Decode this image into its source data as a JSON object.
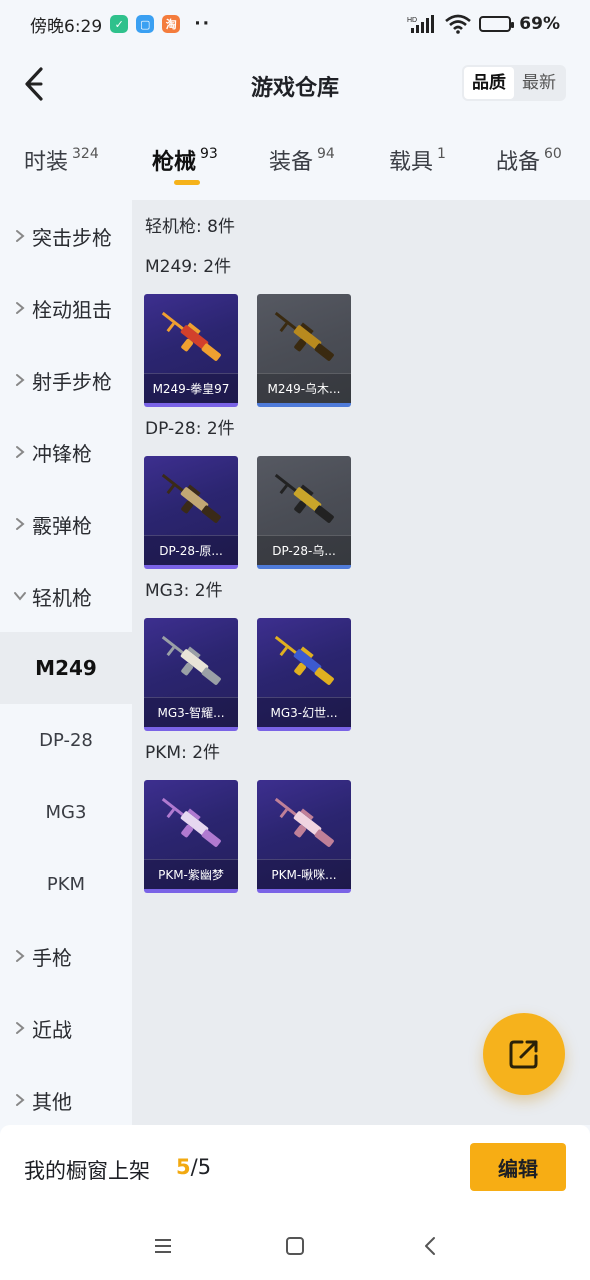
{
  "status_bar": {
    "time": "傍晚6:29",
    "app_icons": [
      {
        "icon": "shield-app-icon",
        "color": "#2fc18c",
        "glyph": "✓"
      },
      {
        "icon": "chat-app-icon",
        "color": "#3aa0f2",
        "glyph": "▢"
      },
      {
        "icon": "taobao-app-icon",
        "color": "#f47c3c",
        "glyph": "淘"
      }
    ],
    "more": "··",
    "network": "HD",
    "battery_percent": 69,
    "battery_text": "69%"
  },
  "header": {
    "title": "游戏仓库",
    "sort_options": [
      "品质",
      "最新"
    ],
    "sort_active": 0
  },
  "tabs": [
    {
      "label": "时装",
      "count": "324"
    },
    {
      "label": "枪械",
      "count": "93",
      "active": true
    },
    {
      "label": "装备",
      "count": "94"
    },
    {
      "label": "载具",
      "count": "1"
    },
    {
      "label": "战备",
      "count": "60"
    }
  ],
  "sidebar": {
    "categories": [
      "突击步枪",
      "栓动狙击",
      "射手步枪",
      "冲锋枪",
      "霰弹枪",
      "轻机枪",
      "手枪",
      "近战",
      "其他"
    ],
    "expanded": "轻机枪",
    "subitems": [
      "M249",
      "DP-28",
      "MG3",
      "PKM"
    ],
    "active_sub": "M249"
  },
  "content": {
    "total": "轻机枪: 8件",
    "groups": [
      {
        "title": "M249: 2件",
        "items": [
          {
            "name": "M249-拳皇97",
            "rarity": "purple",
            "weapon_color": "#d2402c",
            "accent": "#f0a030"
          },
          {
            "name": "M249-乌木...",
            "rarity": "gray",
            "weapon_color": "#b88a1e",
            "accent": "#3a2a10"
          }
        ]
      },
      {
        "title": "DP-28: 2件",
        "items": [
          {
            "name": "DP-28-原...",
            "rarity": "purple",
            "weapon_color": "#c2a774",
            "accent": "#3a2a18"
          },
          {
            "name": "DP-28-乌...",
            "rarity": "gray",
            "weapon_color": "#c9a52a",
            "accent": "#222"
          }
        ]
      },
      {
        "title": "MG3: 2件",
        "items": [
          {
            "name": "MG3-智耀...",
            "rarity": "purple",
            "weapon_color": "#e8e4d8",
            "accent": "#9aa0a6"
          },
          {
            "name": "MG3-幻世...",
            "rarity": "purple",
            "weapon_color": "#3c5ad0",
            "accent": "#e0b020"
          }
        ]
      },
      {
        "title": "PKM: 2件",
        "items": [
          {
            "name": "PKM-紫幽梦",
            "rarity": "purple",
            "weapon_color": "#e6d8f0",
            "accent": "#b07ad0"
          },
          {
            "name": "PKM-啾咪...",
            "rarity": "purple",
            "weapon_color": "#f0d4e0",
            "accent": "#c08098"
          }
        ]
      }
    ]
  },
  "fab": {
    "icon": "share-external-icon",
    "color": "#f6b21c"
  },
  "bottom_bar": {
    "label": "我的橱窗上架",
    "current": "5",
    "separator": "/",
    "max": "5",
    "edit_label": "编辑"
  },
  "system_nav": {
    "icons": [
      "menu-icon",
      "home-square-icon",
      "back-icon"
    ]
  }
}
